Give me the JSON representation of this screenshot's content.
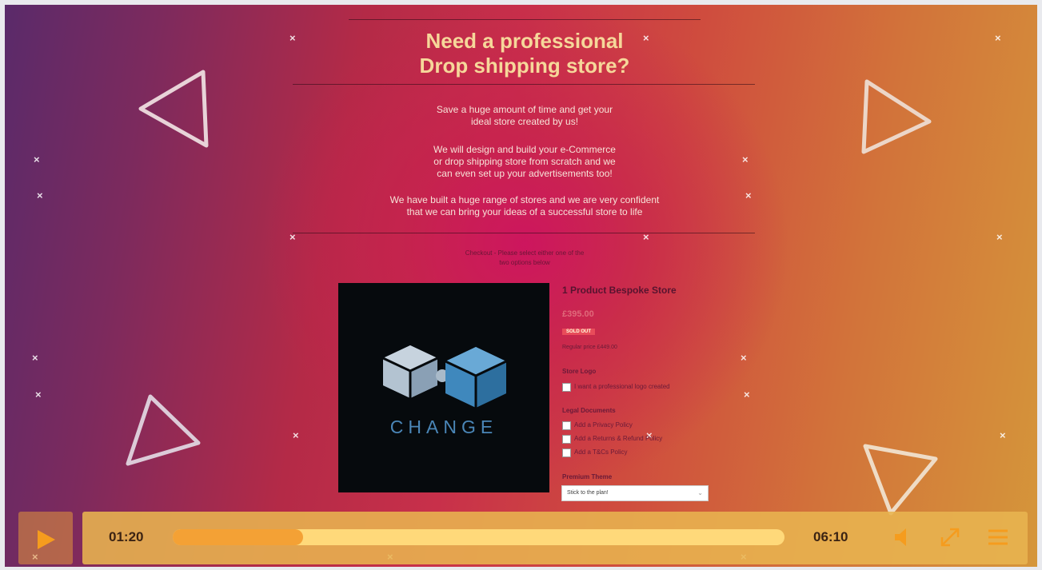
{
  "promo": {
    "headline_line1": "Need a professional",
    "headline_line2": "Drop shipping store?",
    "para1_line1": "Save a huge amount of time and get your",
    "para1_line2": "ideal store created by us!",
    "para2_line1": "We will design and build your e-Commerce",
    "para2_line2": "or drop shipping store from scratch and we",
    "para2_line3": "can even set up your advertisements too!",
    "para3_line1": "We have built a huge range of stores and we are very confident",
    "para3_line2": "that we can bring your ideas of a successful store to life",
    "notice_line1": "Checkout - Please select either one of the",
    "notice_line2": "two options below"
  },
  "product": {
    "image_brand_text": "CHANGE",
    "title": "1 Product Bespoke Store",
    "price": "£395.00",
    "sold_badge": "SOLD OUT",
    "regular_price_text": "Regular price £449.00",
    "store_logo_label": "Store Logo",
    "store_logo_option": "I want a professional logo created",
    "legal_label": "Legal Documents",
    "legal_options": [
      "Add a Privacy Policy",
      "Add a Returns & Refund Policy",
      "Add a T&Cs Policy"
    ],
    "theme_label": "Premium Theme",
    "theme_selected": "Stick to the plan!"
  },
  "player": {
    "current_time": "01:20",
    "total_time": "06:10",
    "progress": 0.213
  },
  "icons": [
    "play-icon",
    "volume-icon",
    "fullscreen-icon",
    "menu-icon"
  ],
  "colors": {
    "headline": "#f6d79a",
    "progress_track": "#ffd97a",
    "progress_fill": "#f4a135",
    "controls_bar": "#e8b450",
    "product_image_bg": "#060a0d",
    "logo_blue": "#4a86b7"
  }
}
